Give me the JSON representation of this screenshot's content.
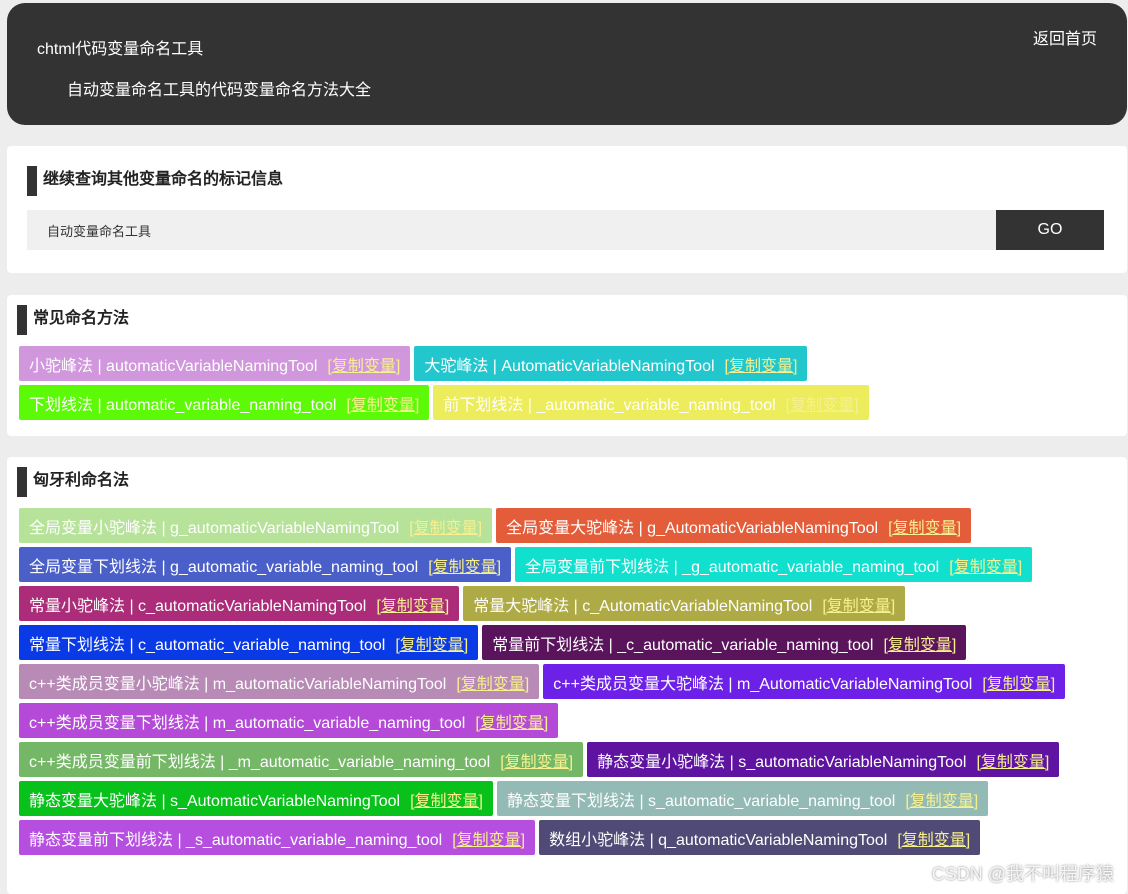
{
  "header": {
    "app_title": "chtml代码变量命名工具",
    "subtitle": "自动变量命名工具的代码变量命名方法大全",
    "home_link": "返回首页"
  },
  "search": {
    "title": "继续查询其他变量命名的标记信息",
    "value": "自动变量命名工具",
    "go_label": "GO"
  },
  "copy_label": "[复制变量]",
  "common": {
    "title": "常见命名方法",
    "items": [
      {
        "text": "小驼峰法 | automaticVariableNamingTool",
        "color": "#d197dc"
      },
      {
        "text": "大驼峰法 | AutomaticVariableNamingTool",
        "color": "#22c7cd"
      },
      {
        "text": "下划线法 | automatic_variable_naming_tool",
        "color": "#5dfa08"
      },
      {
        "text": "前下划线法 | _automatic_variable_naming_tool",
        "color": "#ecec5c"
      }
    ]
  },
  "hungarian": {
    "title": "匈牙利命名法",
    "items": [
      {
        "text": "全局变量小驼峰法 | g_automaticVariableNamingTool",
        "color": "#b6e29a"
      },
      {
        "text": "全局变量大驼峰法 | g_AutomaticVariableNamingTool",
        "color": "#e45d3a"
      },
      {
        "text": "全局变量下划线法 | g_automatic_variable_naming_tool",
        "color": "#4a5fc8"
      },
      {
        "text": "全局变量前下划线法 | _g_automatic_variable_naming_tool",
        "color": "#12e0cf"
      },
      {
        "text": "常量小驼峰法 | c_automaticVariableNamingTool",
        "color": "#ab2d79"
      },
      {
        "text": "常量大驼峰法 | c_AutomaticVariableNamingTool",
        "color": "#aeaa45"
      },
      {
        "text": "常量下划线法 | c_automatic_variable_naming_tool",
        "color": "#0a3ae6"
      },
      {
        "text": "常量前下划线法 | _c_automatic_variable_naming_tool",
        "color": "#5a145c"
      },
      {
        "text": "c++类成员变量小驼峰法 | m_automaticVariableNamingTool",
        "color": "#b88ab6"
      },
      {
        "text": "c++类成员变量大驼峰法 | m_AutomaticVariableNamingTool",
        "color": "#6d21e8"
      },
      {
        "text": "c++类成员变量下划线法 | m_automatic_variable_naming_tool",
        "color": "#b54ad9"
      },
      {
        "text": "c++类成员变量前下划线法 | _m_automatic_variable_naming_tool",
        "color": "#74b766"
      },
      {
        "text": "静态变量小驼峰法 | s_automaticVariableNamingTool",
        "color": "#5f13a1"
      },
      {
        "text": "静态变量大驼峰法 | s_AutomaticVariableNamingTool",
        "color": "#08c11b"
      },
      {
        "text": "静态变量下划线法 | s_automatic_variable_naming_tool",
        "color": "#93bab4"
      },
      {
        "text": "静态变量前下划线法 | _s_automatic_variable_naming_tool",
        "color": "#b64ee0"
      },
      {
        "text": "数组小驼峰法 | q_automaticVariableNamingTool",
        "color": "#4f4a76"
      }
    ]
  },
  "watermark": "CSDN @我不叫程序猿"
}
